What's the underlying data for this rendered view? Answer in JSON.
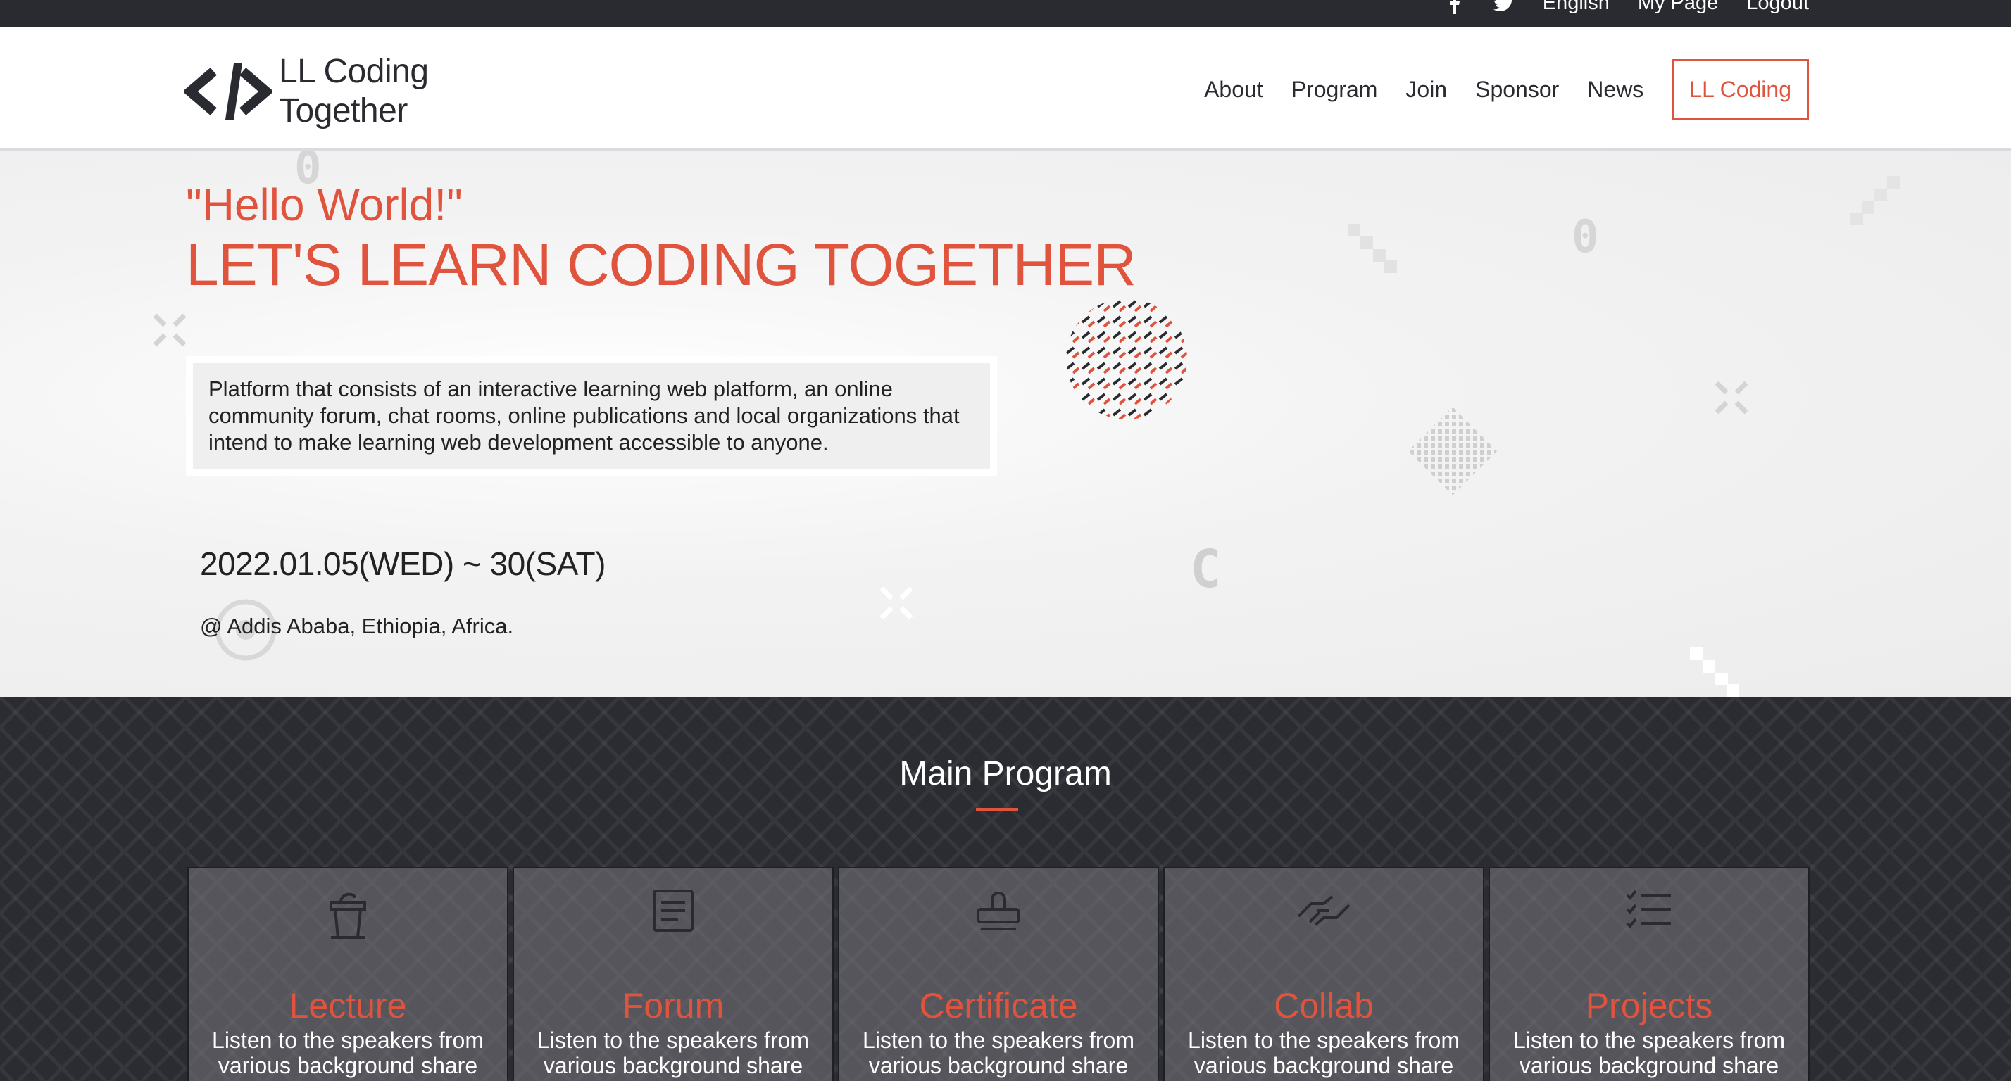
{
  "topbar": {
    "icons": [
      "facebook-icon",
      "twitter-icon"
    ],
    "language": "English",
    "my_page": "My Page",
    "logout": "Logout"
  },
  "header": {
    "logo_line1": "LL Coding",
    "logo_line2": "Together",
    "nav": [
      "About",
      "Program",
      "Join",
      "Sponsor",
      "News"
    ],
    "cta": "LL Coding"
  },
  "hero": {
    "hello": "\"Hello World!\"",
    "headline": "LET'S LEARN CODING TOGETHER",
    "description": "Platform that consists of an interactive learning web platform, an online community forum, chat rooms, online publications and local organizations that intend to make learning web development accessible to anyone.",
    "date": "2022.01.05(WED) ~ 30(SAT)",
    "location": "@ Addis Ababa, Ethiopia, Africa."
  },
  "program": {
    "title": "Main Program",
    "cards": [
      {
        "icon": "podium-icon",
        "title": "Lecture",
        "desc": "Listen to the speakers from various background share"
      },
      {
        "icon": "board-icon",
        "title": "Forum",
        "desc": "Listen to the speakers from various background share"
      },
      {
        "icon": "stamp-icon",
        "title": "Certificate",
        "desc": "Listen to the speakers from various background share"
      },
      {
        "icon": "handshake-icon",
        "title": "Collab",
        "desc": "Listen to the speakers from various background share"
      },
      {
        "icon": "checklist-icon",
        "title": "Projects",
        "desc": "Listen to the speakers from various background share"
      }
    ]
  },
  "colors": {
    "accent": "#e0533d",
    "dark": "#2a2b30"
  }
}
